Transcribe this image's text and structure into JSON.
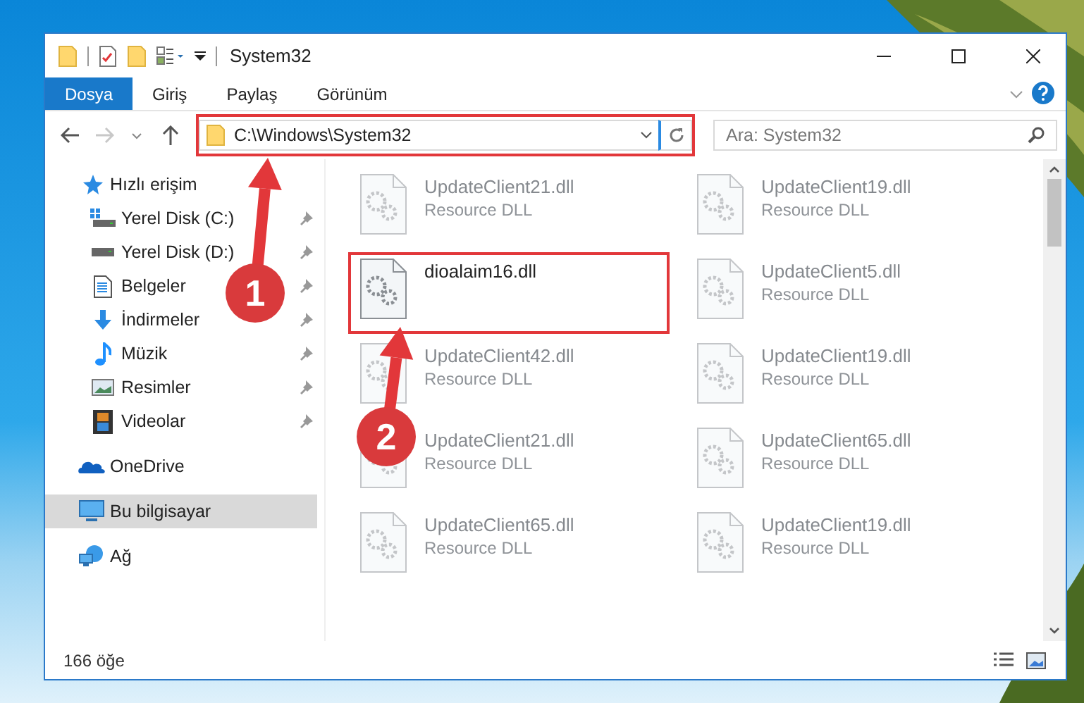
{
  "window": {
    "title": "System32"
  },
  "ribbon_tabs": [
    {
      "label": "Dosya",
      "selected": true
    },
    {
      "label": "Giriş",
      "selected": false
    },
    {
      "label": "Paylaş",
      "selected": false
    },
    {
      "label": "Görünüm",
      "selected": false
    }
  ],
  "nav": {
    "back_disabled": false,
    "forward_disabled": true
  },
  "address": {
    "path": "C:\\Windows\\System32",
    "highlighted": true
  },
  "search": {
    "placeholder": "Ara: System32"
  },
  "sidebar": [
    {
      "label": "Hızlı erişim",
      "kind": "star",
      "selected": false,
      "children": [
        {
          "label": "Yerel Disk (C:)",
          "kind": "drive-windows",
          "pinned": true,
          "selected": false
        },
        {
          "label": "Yerel Disk (D:)",
          "kind": "drive",
          "pinned": true,
          "selected": false
        },
        {
          "label": "Belgeler",
          "kind": "document",
          "pinned": true,
          "selected": false
        },
        {
          "label": "İndirmeler",
          "kind": "download",
          "pinned": true,
          "selected": false
        },
        {
          "label": "Müzik",
          "kind": "music",
          "pinned": true,
          "selected": false
        },
        {
          "label": "Resimler",
          "kind": "picture",
          "pinned": true,
          "selected": false
        },
        {
          "label": "Videolar",
          "kind": "video",
          "pinned": true,
          "selected": false
        }
      ]
    },
    {
      "label": "OneDrive",
      "kind": "cloud",
      "selected": false
    },
    {
      "label": "Bu bilgisayar",
      "kind": "computer",
      "selected": true
    },
    {
      "label": "Ağ",
      "kind": "network",
      "selected": false
    }
  ],
  "files": [
    {
      "name": "UpdateClient21.dll",
      "type": "Resource DLL",
      "dimmed": true,
      "highlighted": false
    },
    {
      "name": "UpdateClient19.dll",
      "type": "Resource DLL",
      "dimmed": true,
      "highlighted": false
    },
    {
      "name": "dioalaim16.dll",
      "dimmed": false,
      "highlighted": true
    },
    {
      "name": "UpdateClient5.dll",
      "type": "Resource DLL",
      "dimmed": true,
      "highlighted": false
    },
    {
      "name": "UpdateClient42.dll",
      "type": "Resource DLL",
      "dimmed": true,
      "highlighted": false
    },
    {
      "name": "UpdateClient19.dll",
      "type": "Resource DLL",
      "dimmed": true,
      "highlighted": false
    },
    {
      "name": "UpdateClient21.dll",
      "type": "Resource DLL",
      "dimmed": true,
      "highlighted": false
    },
    {
      "name": "UpdateClient65.dll",
      "type": "Resource DLL",
      "dimmed": true,
      "highlighted": false
    },
    {
      "name": "UpdateClient65.dll",
      "type": "Resource DLL",
      "dimmed": true,
      "highlighted": false
    },
    {
      "name": "UpdateClient19.dll",
      "type": "Resource DLL",
      "dimmed": true,
      "highlighted": false
    }
  ],
  "status_bar": {
    "count": "166 öğe"
  },
  "callouts": [
    {
      "number": "1"
    },
    {
      "number": "2"
    }
  ]
}
